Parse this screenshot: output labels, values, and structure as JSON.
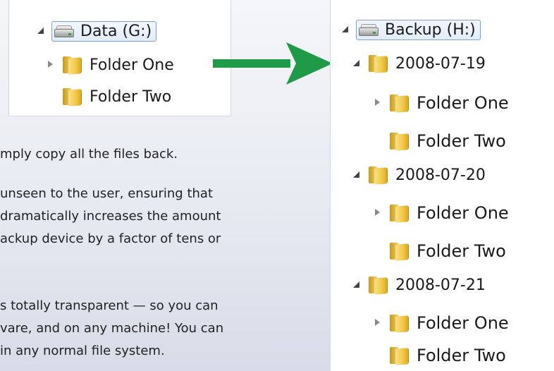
{
  "left_tree": {
    "drive_label": "Data (G:)",
    "folders": [
      "Folder One",
      "Folder Two"
    ]
  },
  "right_tree": {
    "drive_label": "Backup (H:)",
    "snapshots": [
      {
        "date": "2008-07-19",
        "folders": [
          "Folder One",
          "Folder Two"
        ]
      },
      {
        "date": "2008-07-20",
        "folders": [
          "Folder One",
          "Folder Two"
        ]
      },
      {
        "date": "2008-07-21",
        "folders": [
          "Folder One",
          "Folder Two"
        ]
      }
    ]
  },
  "body_text": {
    "line1": "mply copy all the files back.",
    "p2": [
      "unseen to the user, ensuring that",
      "dramatically increases the amount",
      "ackup device by a factor of tens or"
    ],
    "p3": [
      "s totally transparent — so you can",
      "vare, and on any machine! You can",
      " in any normal file system."
    ]
  },
  "colors": {
    "arrow": "#1f9a48",
    "selection_border": "#7da2ce"
  },
  "icons": [
    "drive-icon",
    "folder-icon",
    "expand-arrow-icon",
    "collapse-arrow-icon",
    "green-arrow-icon"
  ]
}
